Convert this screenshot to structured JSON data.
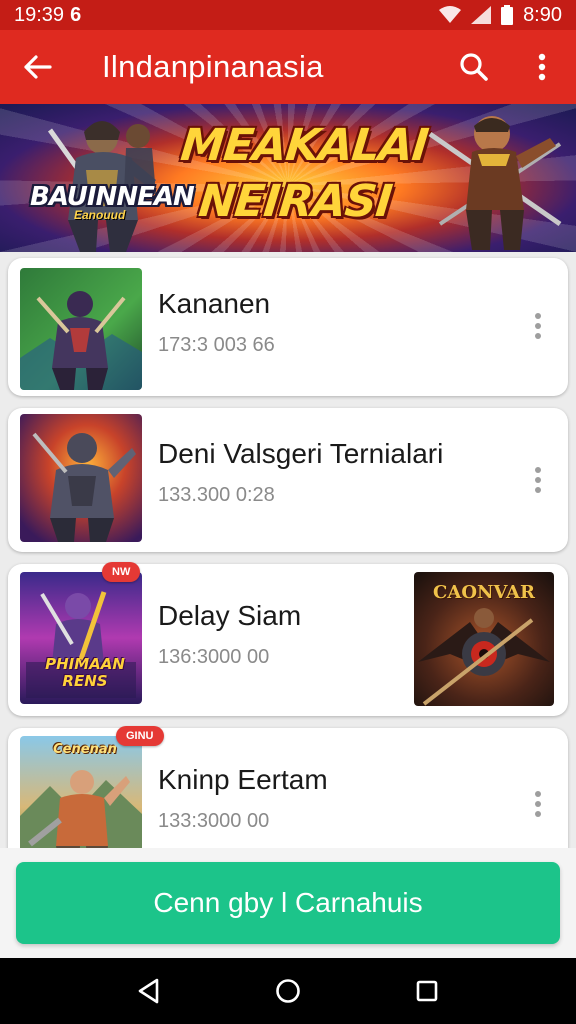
{
  "status_bar": {
    "time": "19:39",
    "notification_glyph": "6",
    "battery_text": "8:90",
    "icons": [
      "wifi-icon",
      "signal-icon",
      "battery-icon"
    ]
  },
  "app_bar": {
    "title": "Ilndanpinanasia",
    "back_icon": "arrow-left-icon",
    "actions": [
      "search-icon",
      "more-vert-icon"
    ]
  },
  "banner": {
    "headline_line1": "MEAKALAI",
    "headline_line2": "NEIRASI",
    "left_logo": "BAUINNEAN",
    "left_logo_sub": "Eanouud"
  },
  "list": {
    "items": [
      {
        "name": "Kananen",
        "meta": "173:3 003 66",
        "badge": "",
        "more_icon": "more-vert-icon"
      },
      {
        "name": "Deni Valsgeri Ternialari",
        "meta": "133.300 0:28",
        "badge": "",
        "more_icon": "more-vert-icon"
      },
      {
        "name": "Delay Siam",
        "meta": "136:3000 00",
        "badge": "NW",
        "thumb_text": "PHIMAAN RENS",
        "side_art_title": "CAONVAR"
      },
      {
        "name": "Kninp Eertam",
        "meta": "133:3000 00",
        "badge": "GINU",
        "thumb_text": "Cenenan",
        "more_icon": "more-vert-icon"
      }
    ]
  },
  "cta": {
    "label": "Cenn gby l Carnahuis"
  },
  "nav": {
    "icons": [
      "back-triangle-icon",
      "home-circle-icon",
      "recents-square-icon"
    ]
  },
  "colors": {
    "status_bar": "#c41d16",
    "app_bar": "#df2a20",
    "cta": "#1cc48a"
  }
}
